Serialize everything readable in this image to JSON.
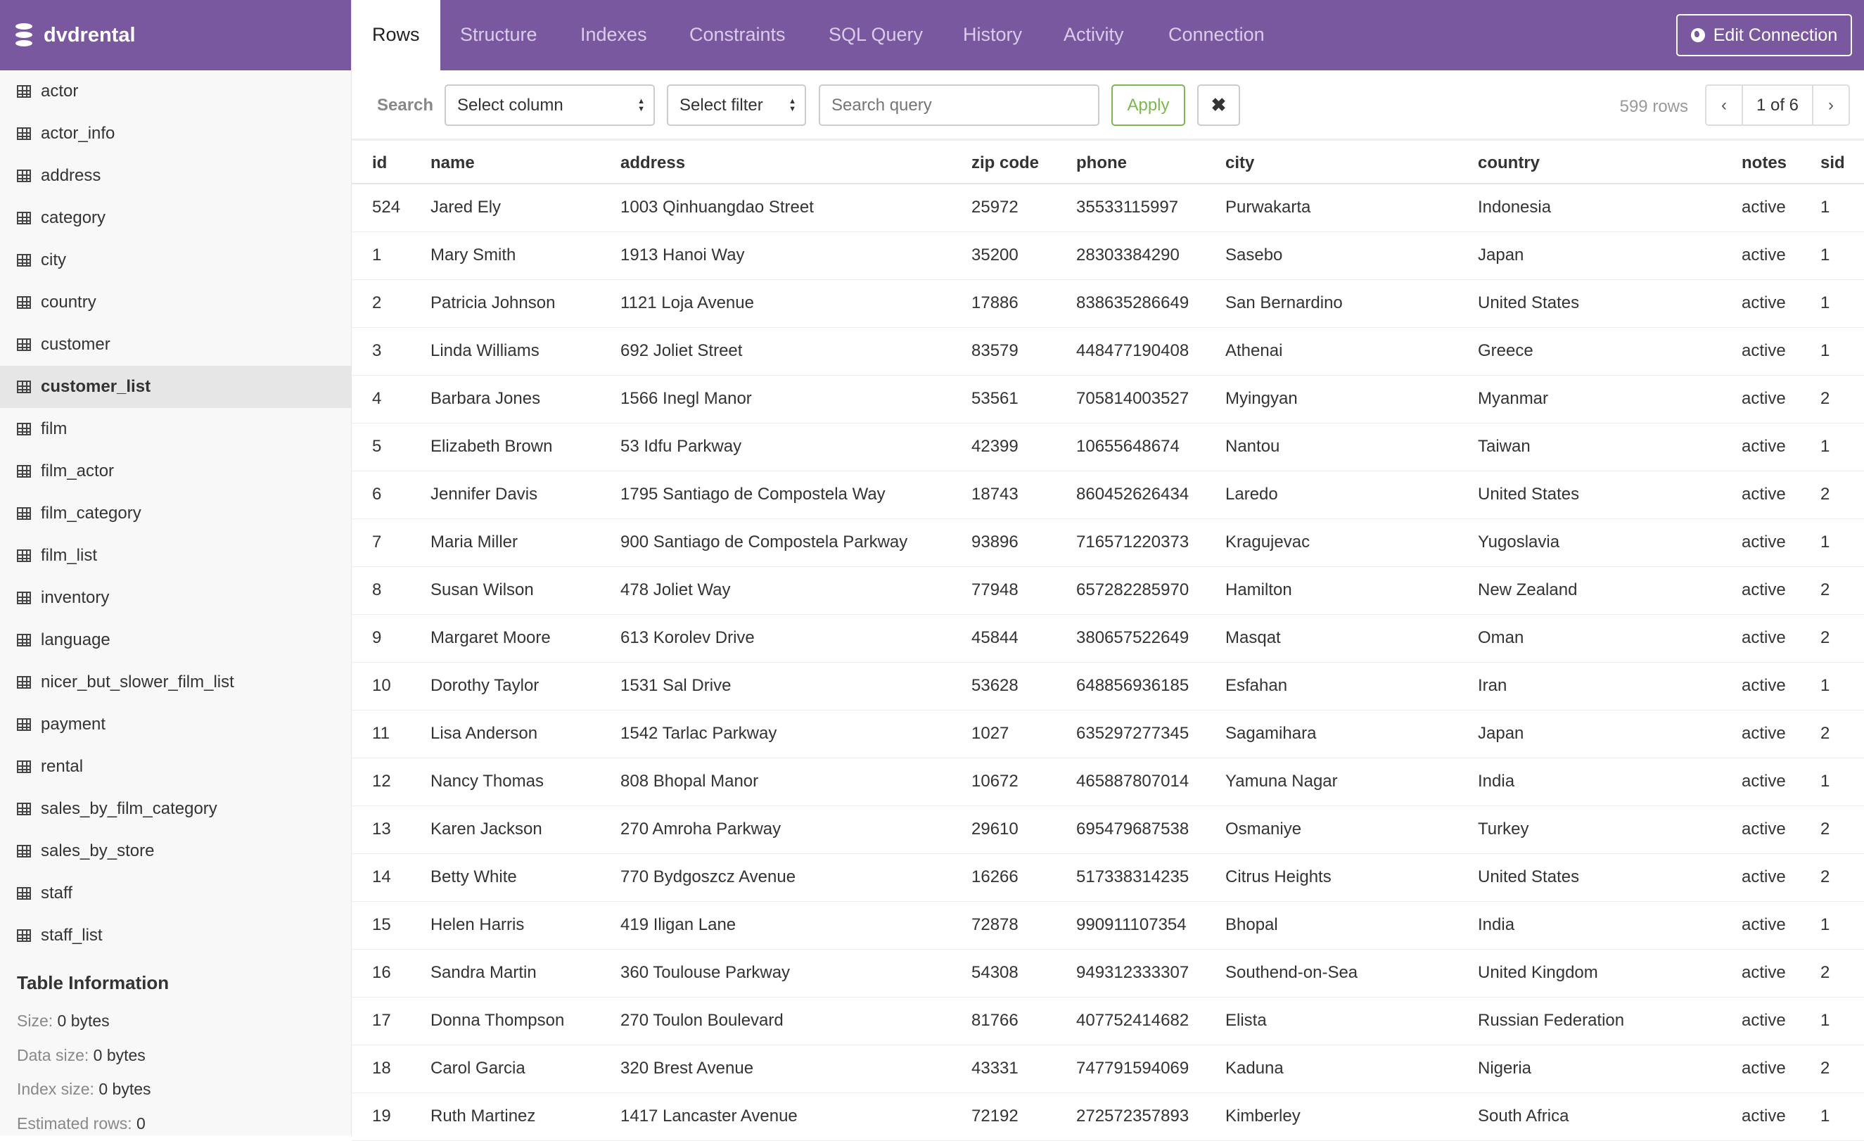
{
  "app": {
    "db_name": "dvdrental",
    "colors": {
      "brand": "#79589f",
      "apply": "#7cb84f"
    }
  },
  "sidebar": {
    "items": [
      "actor",
      "actor_info",
      "address",
      "category",
      "city",
      "country",
      "customer",
      "customer_list",
      "film",
      "film_actor",
      "film_category",
      "film_list",
      "inventory",
      "language",
      "nicer_but_slower_film_list",
      "payment",
      "rental",
      "sales_by_film_category",
      "sales_by_store",
      "staff",
      "staff_list"
    ],
    "active": "customer_list",
    "info": {
      "title": "Table Information",
      "size_label": "Size:",
      "size": "0 bytes",
      "data_label": "Data size:",
      "data": "0 bytes",
      "index_label": "Index size:",
      "index": "0 bytes",
      "rows_label": "Estimated rows:",
      "rows": "0"
    }
  },
  "tabs": [
    {
      "label": "Rows"
    },
    {
      "label": "Structure"
    },
    {
      "label": "Indexes"
    },
    {
      "label": "Constraints"
    },
    {
      "label": "SQL Query"
    },
    {
      "label": "History"
    },
    {
      "label": "Activity"
    },
    {
      "label": "Connection"
    }
  ],
  "edit_connection": "Edit Connection",
  "toolbar": {
    "search_label": "Search",
    "column_select": "Select column",
    "filter_select": "Select filter",
    "query_placeholder": "Search query",
    "apply": "Apply",
    "clear": "✖",
    "row_count": "599 rows",
    "page": "1 of 6",
    "prev": "‹",
    "next": "›"
  },
  "table": {
    "columns": [
      "id",
      "name",
      "address",
      "zip code",
      "phone",
      "city",
      "country",
      "notes",
      "sid"
    ],
    "rows": [
      [
        "524",
        "Jared Ely",
        "1003 Qinhuangdao Street",
        "25972",
        "35533115997",
        "Purwakarta",
        "Indonesia",
        "active",
        "1"
      ],
      [
        "1",
        "Mary Smith",
        "1913 Hanoi Way",
        "35200",
        "28303384290",
        "Sasebo",
        "Japan",
        "active",
        "1"
      ],
      [
        "2",
        "Patricia Johnson",
        "1121 Loja Avenue",
        "17886",
        "838635286649",
        "San Bernardino",
        "United States",
        "active",
        "1"
      ],
      [
        "3",
        "Linda Williams",
        "692 Joliet Street",
        "83579",
        "448477190408",
        "Athenai",
        "Greece",
        "active",
        "1"
      ],
      [
        "4",
        "Barbara Jones",
        "1566 Inegl Manor",
        "53561",
        "705814003527",
        "Myingyan",
        "Myanmar",
        "active",
        "2"
      ],
      [
        "5",
        "Elizabeth Brown",
        "53 Idfu Parkway",
        "42399",
        "10655648674",
        "Nantou",
        "Taiwan",
        "active",
        "1"
      ],
      [
        "6",
        "Jennifer Davis",
        "1795 Santiago de Compostela Way",
        "18743",
        "860452626434",
        "Laredo",
        "United States",
        "active",
        "2"
      ],
      [
        "7",
        "Maria Miller",
        "900 Santiago de Compostela Parkway",
        "93896",
        "716571220373",
        "Kragujevac",
        "Yugoslavia",
        "active",
        "1"
      ],
      [
        "8",
        "Susan Wilson",
        "478 Joliet Way",
        "77948",
        "657282285970",
        "Hamilton",
        "New Zealand",
        "active",
        "2"
      ],
      [
        "9",
        "Margaret Moore",
        "613 Korolev Drive",
        "45844",
        "380657522649",
        "Masqat",
        "Oman",
        "active",
        "2"
      ],
      [
        "10",
        "Dorothy Taylor",
        "1531 Sal Drive",
        "53628",
        "648856936185",
        "Esfahan",
        "Iran",
        "active",
        "1"
      ],
      [
        "11",
        "Lisa Anderson",
        "1542 Tarlac Parkway",
        "1027",
        "635297277345",
        "Sagamihara",
        "Japan",
        "active",
        "2"
      ],
      [
        "12",
        "Nancy Thomas",
        "808 Bhopal Manor",
        "10672",
        "465887807014",
        "Yamuna Nagar",
        "India",
        "active",
        "1"
      ],
      [
        "13",
        "Karen Jackson",
        "270 Amroha Parkway",
        "29610",
        "695479687538",
        "Osmaniye",
        "Turkey",
        "active",
        "2"
      ],
      [
        "14",
        "Betty White",
        "770 Bydgoszcz Avenue",
        "16266",
        "517338314235",
        "Citrus Heights",
        "United States",
        "active",
        "2"
      ],
      [
        "15",
        "Helen Harris",
        "419 Iligan Lane",
        "72878",
        "990911107354",
        "Bhopal",
        "India",
        "active",
        "1"
      ],
      [
        "16",
        "Sandra Martin",
        "360 Toulouse Parkway",
        "54308",
        "949312333307",
        "Southend-on-Sea",
        "United Kingdom",
        "active",
        "2"
      ],
      [
        "17",
        "Donna Thompson",
        "270 Toulon Boulevard",
        "81766",
        "407752414682",
        "Elista",
        "Russian Federation",
        "active",
        "1"
      ],
      [
        "18",
        "Carol Garcia",
        "320 Brest Avenue",
        "43331",
        "747791594069",
        "Kaduna",
        "Nigeria",
        "active",
        "2"
      ],
      [
        "19",
        "Ruth Martinez",
        "1417 Lancaster Avenue",
        "72192",
        "272572357893",
        "Kimberley",
        "South Africa",
        "active",
        "1"
      ]
    ]
  }
}
